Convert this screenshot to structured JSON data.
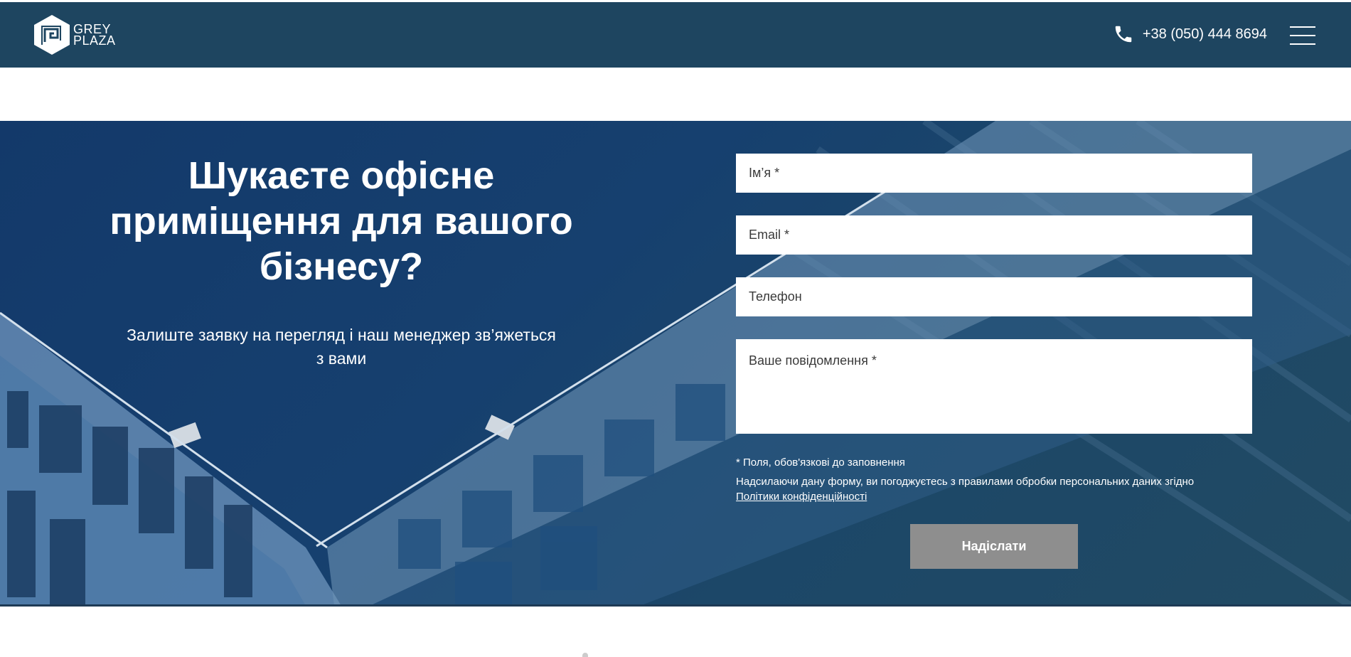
{
  "header": {
    "logo_line1": "GREY",
    "logo_line2": "PLAZA",
    "phone": "+38 (050) 444 8694",
    "menu_icon": "hamburger-menu-icon",
    "phone_icon": "phone-icon"
  },
  "hero": {
    "title": "Шукаєте офісне приміщення для вашого бізнесу?",
    "subtitle": "Залиште заявку на перегляд і наш менеджер зв’яжеться з вами"
  },
  "form": {
    "name_placeholder": "Ім’я *",
    "email_placeholder": "Email *",
    "phone_placeholder": "Телефон",
    "message_placeholder": "Ваше повідомлення *",
    "required_note": "*  Поля, обов'язкові до заповнення",
    "consent_text": "Надсилаючи дану форму, ви погоджуєтесь з правилами обробки персональних даних згідно",
    "privacy_link": "Політики конфіденційності",
    "submit_label": "Надіслати"
  },
  "colors": {
    "header_bg": "#1e4560",
    "hero_bg": "#16406f",
    "submit_bg": "#8e8e8e"
  }
}
